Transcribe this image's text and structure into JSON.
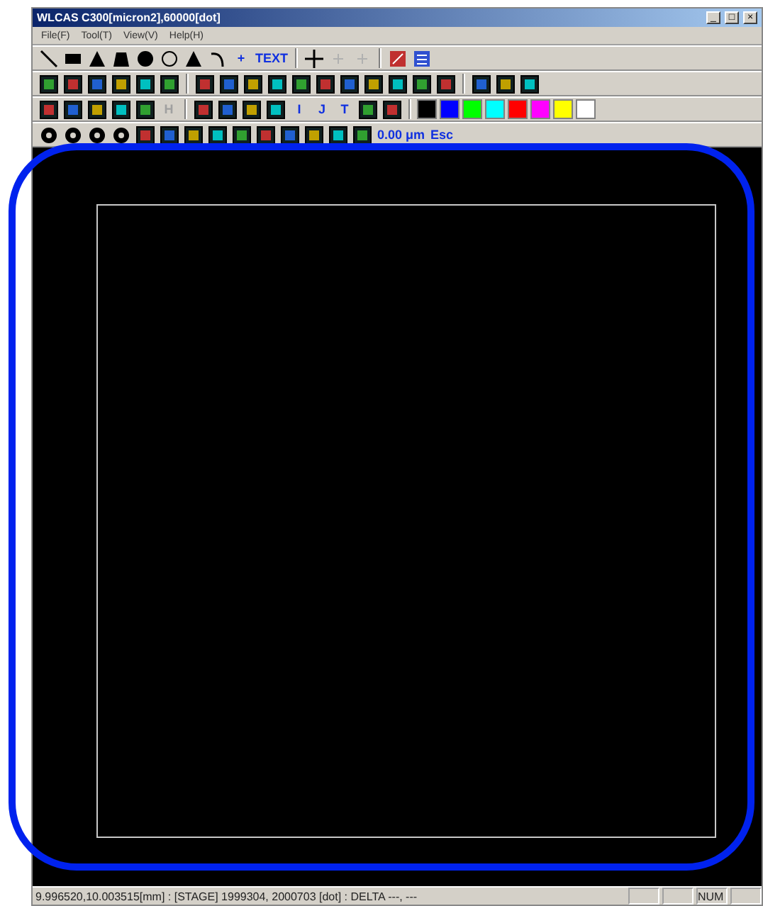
{
  "window": {
    "title": "WLCAS C300[micron2],60000[dot]",
    "controls": [
      "_",
      "□",
      "×"
    ]
  },
  "menu": [
    {
      "label": "File(F)"
    },
    {
      "label": "Tool(T)"
    },
    {
      "label": "View(V)"
    },
    {
      "label": "Help(H)"
    }
  ],
  "toolbars": [
    {
      "items": [
        {
          "kind": "icon"
        },
        {
          "kind": "icon"
        },
        {
          "kind": "icon"
        },
        {
          "kind": "icon"
        },
        {
          "kind": "icon"
        },
        {
          "kind": "icon"
        },
        {
          "kind": "icon"
        },
        {
          "kind": "icon"
        },
        {
          "kind": "text",
          "label": "+",
          "disabled": false
        },
        {
          "kind": "text",
          "label": "TEXT",
          "disabled": false
        },
        {
          "kind": "sep"
        },
        {
          "kind": "icon"
        },
        {
          "kind": "icon"
        },
        {
          "kind": "icon"
        },
        {
          "kind": "sep"
        },
        {
          "kind": "icon"
        },
        {
          "kind": "icon"
        }
      ]
    },
    {
      "items": [
        {
          "kind": "icon"
        },
        {
          "kind": "icon"
        },
        {
          "kind": "icon"
        },
        {
          "kind": "icon"
        },
        {
          "kind": "icon"
        },
        {
          "kind": "icon"
        },
        {
          "kind": "sep"
        },
        {
          "kind": "icon"
        },
        {
          "kind": "icon"
        },
        {
          "kind": "icon"
        },
        {
          "kind": "icon"
        },
        {
          "kind": "icon"
        },
        {
          "kind": "icon"
        },
        {
          "kind": "icon"
        },
        {
          "kind": "icon"
        },
        {
          "kind": "icon"
        },
        {
          "kind": "icon"
        },
        {
          "kind": "icon"
        },
        {
          "kind": "sep"
        },
        {
          "kind": "icon"
        },
        {
          "kind": "icon"
        },
        {
          "kind": "icon"
        }
      ]
    },
    {
      "items": [
        {
          "kind": "icon"
        },
        {
          "kind": "icon"
        },
        {
          "kind": "icon"
        },
        {
          "kind": "icon"
        },
        {
          "kind": "icon"
        },
        {
          "kind": "text",
          "label": "H",
          "disabled": true
        },
        {
          "kind": "sep"
        },
        {
          "kind": "icon"
        },
        {
          "kind": "icon"
        },
        {
          "kind": "icon"
        },
        {
          "kind": "icon"
        },
        {
          "kind": "text",
          "label": "I",
          "disabled": false
        },
        {
          "kind": "text",
          "label": "J",
          "disabled": false
        },
        {
          "kind": "text",
          "label": "T",
          "disabled": false
        },
        {
          "kind": "icon"
        },
        {
          "kind": "icon"
        },
        {
          "kind": "sep"
        },
        {
          "kind": "swatch",
          "color": "#000000"
        },
        {
          "kind": "swatch",
          "color": "#0000ff"
        },
        {
          "kind": "swatch",
          "color": "#00ff00"
        },
        {
          "kind": "swatch",
          "color": "#00ffff"
        },
        {
          "kind": "swatch",
          "color": "#ff0000"
        },
        {
          "kind": "swatch",
          "color": "#ff00ff"
        },
        {
          "kind": "swatch",
          "color": "#ffff00"
        },
        {
          "kind": "swatch",
          "color": "#ffffff"
        }
      ]
    },
    {
      "items": [
        {
          "kind": "icon"
        },
        {
          "kind": "icon"
        },
        {
          "kind": "icon"
        },
        {
          "kind": "icon"
        },
        {
          "kind": "icon"
        },
        {
          "kind": "icon"
        },
        {
          "kind": "icon"
        },
        {
          "kind": "icon"
        },
        {
          "kind": "icon"
        },
        {
          "kind": "icon"
        },
        {
          "kind": "icon"
        },
        {
          "kind": "icon"
        },
        {
          "kind": "icon"
        },
        {
          "kind": "icon"
        },
        {
          "kind": "text",
          "label": "0.00 μm",
          "disabled": false
        },
        {
          "kind": "text",
          "label": "Esc",
          "disabled": false
        }
      ]
    }
  ],
  "status_bar": {
    "text": "9.996520,10.003515[mm] : [STAGE] 1999304, 2000703 [dot] : DELTA ---, ---",
    "panels": [
      "NUM"
    ]
  }
}
